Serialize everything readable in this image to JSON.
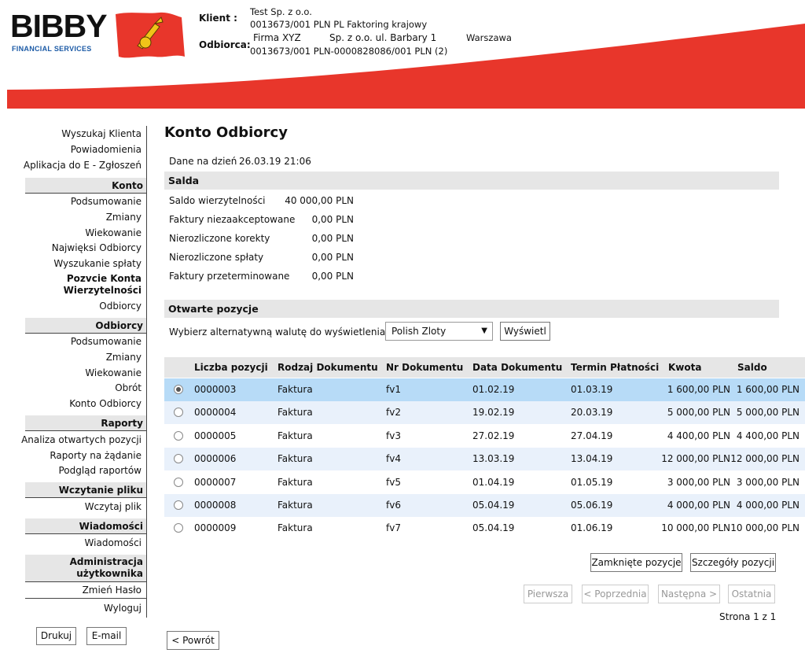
{
  "header": {
    "logo": "BIBBY",
    "logo_sub": "FINANCIAL SERVICES",
    "klient_label": "Klient :",
    "klient_name": "Test Sp. z o.o.",
    "klient_account": "0013673/001 PLN PL Faktoring krajowy",
    "odbiorca_label": "Odbiorca:",
    "odbiorca_name": "Firma XYZ",
    "odbiorca_address": "Sp. z o.o. ul. Barbary 1",
    "odbiorca_city": "Warszawa",
    "odbiorca_account": "0013673/001 PLN-0000828086/001 PLN (2)"
  },
  "sidebar": {
    "top_links": [
      "Wyszukaj Klienta",
      "Powiadomienia",
      "Aplikacja do E - Zgłoszeń"
    ],
    "konto": {
      "heading": "Konto",
      "items": [
        "Podsumowanie",
        "Zmiany",
        "Wiekowanie",
        "Najwięksi Odbiorcy",
        "Wyszukanie spłaty"
      ]
    },
    "pozycje": {
      "heading": "Pozvcie Konta Wierzytelności",
      "items": [
        "Odbiorcy"
      ]
    },
    "odbiorcy": {
      "heading": "Odbiorcy",
      "items": [
        "Podsumowanie",
        "Zmiany",
        "Wiekowanie",
        "Obrót",
        "Konto Odbiorcy"
      ]
    },
    "raporty": {
      "heading": "Raporty",
      "items": [
        "Analiza otwartych pozycji",
        "Raporty na żądanie",
        "Podgląd raportów"
      ]
    },
    "wczytanie": {
      "heading": "Wczytanie pliku",
      "items": [
        "Wczytaj plik"
      ]
    },
    "wiadomosci": {
      "heading": "Wiadomości",
      "items": [
        "Wiadomości"
      ]
    },
    "admin": {
      "heading": "Administracja użytkownika",
      "items": [
        "Zmień Hasło"
      ]
    },
    "logout": "Wyloguj",
    "print_button": "Drukuj",
    "email_button": "E-mail"
  },
  "main": {
    "title": "Konto Odbiorcy",
    "date_label": "Dane na dzień",
    "date_value": "26.03.19 21:06",
    "saldo_heading": "Salda",
    "saldo_rows": [
      {
        "label": "Saldo wierzytelności",
        "value": "40 000,00 PLN"
      },
      {
        "label": "Faktury niezaakceptowane",
        "value": "0,00 PLN"
      },
      {
        "label": "Nierozliczone korekty",
        "value": "0,00 PLN"
      },
      {
        "label": "Nierozliczone spłaty",
        "value": "0,00 PLN"
      },
      {
        "label": "Faktury przeterminowane",
        "value": "0,00 PLN"
      }
    ],
    "open_heading": "Otwarte pozycje",
    "currency_label": "Wybierz alternatywną walutę do wyświetlenia",
    "currency_selected": "Polish Zloty",
    "show_button": "Wyświetl",
    "columns": [
      "Liczba pozycji",
      "Rodzaj Dokumentu",
      "Nr Dokumentu",
      "Data Dokumentu",
      "Termin Płatności",
      "Kwota",
      "Saldo"
    ],
    "rows": [
      {
        "num": "0000003",
        "type": "Faktura",
        "doc": "fv1",
        "date": "01.02.19",
        "due": "01.03.19",
        "amount": "1 600,00 PLN",
        "balance": "1 600,00 PLN",
        "selected": true
      },
      {
        "num": "0000004",
        "type": "Faktura",
        "doc": "fv2",
        "date": "19.02.19",
        "due": "20.03.19",
        "amount": "5 000,00 PLN",
        "balance": "5 000,00 PLN",
        "selected": false
      },
      {
        "num": "0000005",
        "type": "Faktura",
        "doc": "fv3",
        "date": "27.02.19",
        "due": "27.04.19",
        "amount": "4 400,00 PLN",
        "balance": "4 400,00 PLN",
        "selected": false
      },
      {
        "num": "0000006",
        "type": "Faktura",
        "doc": "fv4",
        "date": "13.03.19",
        "due": "13.04.19",
        "amount": "12 000,00 PLN",
        "balance": "12 000,00 PLN",
        "selected": false
      },
      {
        "num": "0000007",
        "type": "Faktura",
        "doc": "fv5",
        "date": "01.04.19",
        "due": "01.05.19",
        "amount": "3 000,00 PLN",
        "balance": "3 000,00 PLN",
        "selected": false
      },
      {
        "num": "0000008",
        "type": "Faktura",
        "doc": "fv6",
        "date": "05.04.19",
        "due": "05.06.19",
        "amount": "4 000,00 PLN",
        "balance": "4 000,00 PLN",
        "selected": false
      },
      {
        "num": "0000009",
        "type": "Faktura",
        "doc": "fv7",
        "date": "05.04.19",
        "due": "01.06.19",
        "amount": "10 000,00 PLN",
        "balance": "10 000,00 PLN",
        "selected": false
      }
    ],
    "closed_button": "Zamknięte pozycje",
    "details_button": "Szczegóły pozycji",
    "pager": {
      "first": "Pierwsza",
      "prev": "< Poprzednia",
      "next": "Następna >",
      "last": "Ostatnia",
      "status": "Strona 1 z 1"
    },
    "back_button": "< Powrót"
  },
  "colors": {
    "brand_red": "#e8362b",
    "brand_blue": "#1b5aa6",
    "selected_row": "#b7dbf7",
    "alt_row": "#e9f1fb",
    "section_gray": "#e6e6e6"
  }
}
